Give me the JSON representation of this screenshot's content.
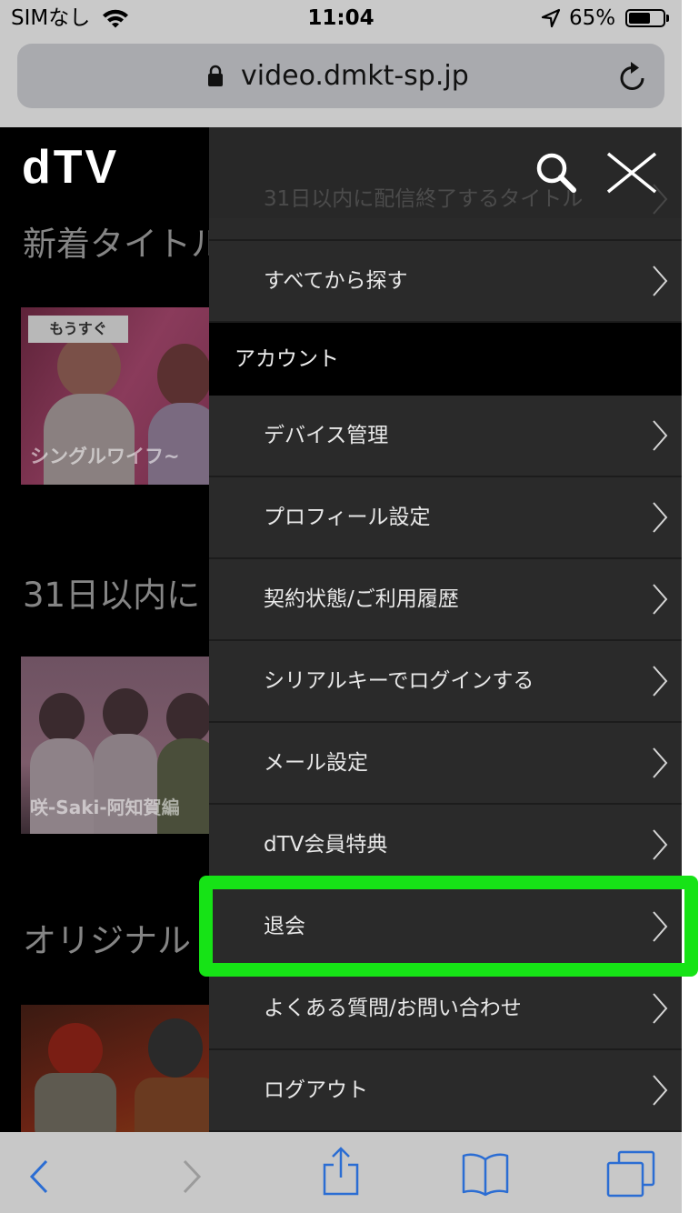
{
  "status_bar": {
    "carrier": "SIMなし",
    "time": "11:04",
    "battery_percent_label": "65%",
    "battery_level": 0.65,
    "icons": [
      "wifi-icon",
      "location-arrow-icon",
      "battery-icon"
    ]
  },
  "address_bar": {
    "url": "video.dmkt-sp.jp",
    "secure": true,
    "icons": [
      "lock-icon",
      "reload-icon"
    ]
  },
  "page": {
    "logo": "dTV",
    "sections": [
      {
        "heading": "新着タイトル",
        "thumbnail": {
          "badge": "もうすぐ",
          "caption": "シングルワイフ~"
        }
      },
      {
        "heading": "31日以内に",
        "thumbnail": {
          "caption": "咲-Saki-阿知賀編"
        }
      },
      {
        "heading": "オリジナル",
        "thumbnail": {}
      }
    ]
  },
  "menu": {
    "header_icons": [
      "search-icon",
      "close-icon"
    ],
    "browse_items": [
      {
        "label": "31日以内に配信終了するタイトル"
      },
      {
        "label": "すべてから探す"
      }
    ],
    "account_section": {
      "title": "アカウント",
      "items": [
        {
          "label": "デバイス管理"
        },
        {
          "label": "プロフィール設定"
        },
        {
          "label": "契約状態/ご利用履歴"
        },
        {
          "label": "シリアルキーでログインする"
        },
        {
          "label": "メール設定"
        },
        {
          "label": "dTV会員特典"
        },
        {
          "label": "退会",
          "highlighted": true
        },
        {
          "label": "よくある質問/お問い合わせ"
        },
        {
          "label": "ログアウト"
        }
      ]
    }
  },
  "toolbar": {
    "buttons": [
      {
        "icon": "back-icon",
        "enabled": true
      },
      {
        "icon": "forward-icon",
        "enabled": false
      },
      {
        "icon": "share-icon",
        "enabled": true
      },
      {
        "icon": "bookmarks-icon",
        "enabled": true
      },
      {
        "icon": "tabs-icon",
        "enabled": true
      }
    ]
  },
  "colors": {
    "highlight": "#16e316",
    "toolbar_active": "#2b6dd3",
    "toolbar_disabled": "#9b9b9b",
    "system_bar_bg": "#c9c9c9",
    "address_field_bg": "#a9aaae",
    "menu_bg": "#2a2a2a"
  }
}
